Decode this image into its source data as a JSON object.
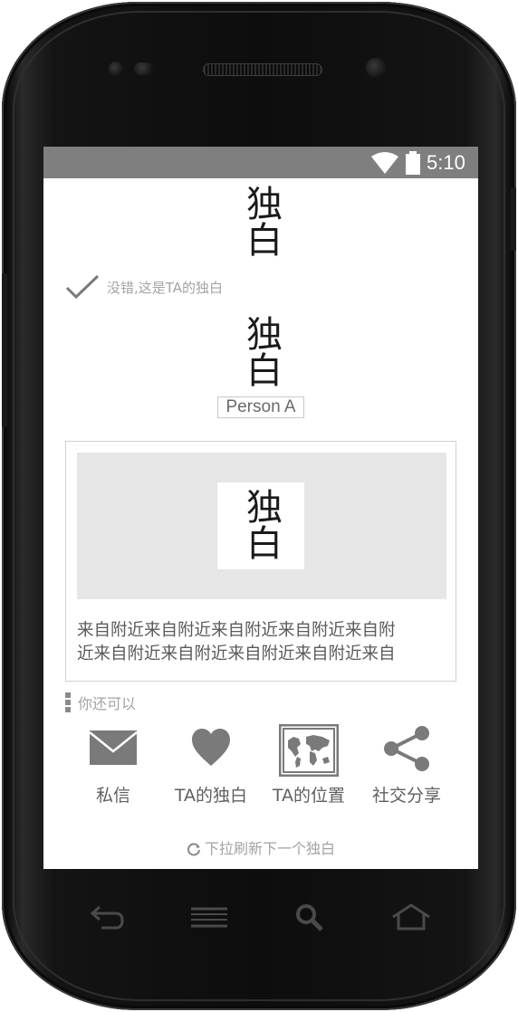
{
  "status_bar": {
    "time": "5:10",
    "icons": [
      "wifi-icon",
      "battery-icon"
    ]
  },
  "app": {
    "logo_text": "独白",
    "check_text": "没错,这是TA的独白",
    "profile": {
      "name": "Person A"
    },
    "card": {
      "text_line1": "来自附近来自附近来自附近来自附近来自附",
      "text_line2": "近来自附近来自附近来自附近来自附近来自"
    },
    "hint_text": "你还可以",
    "actions": [
      {
        "label": "私信",
        "icon": "mail-icon"
      },
      {
        "label": "TA的独白",
        "icon": "heart-icon"
      },
      {
        "label": "TA的位置",
        "icon": "world-map-icon"
      },
      {
        "label": "社交分享",
        "icon": "share-icon"
      }
    ],
    "refresh_text": "下拉刷新下一个独白"
  },
  "nav_keys": [
    "back-icon",
    "menu-icon",
    "search-icon",
    "home-icon"
  ],
  "colors": {
    "status_bar": "#7f7f7f",
    "icon_gray": "#7a7a7a",
    "label_gray": "#5f5f5f",
    "hint_gray": "#a3a3a3",
    "image_placeholder": "#e6e6e6",
    "phone_body": "#141414"
  }
}
